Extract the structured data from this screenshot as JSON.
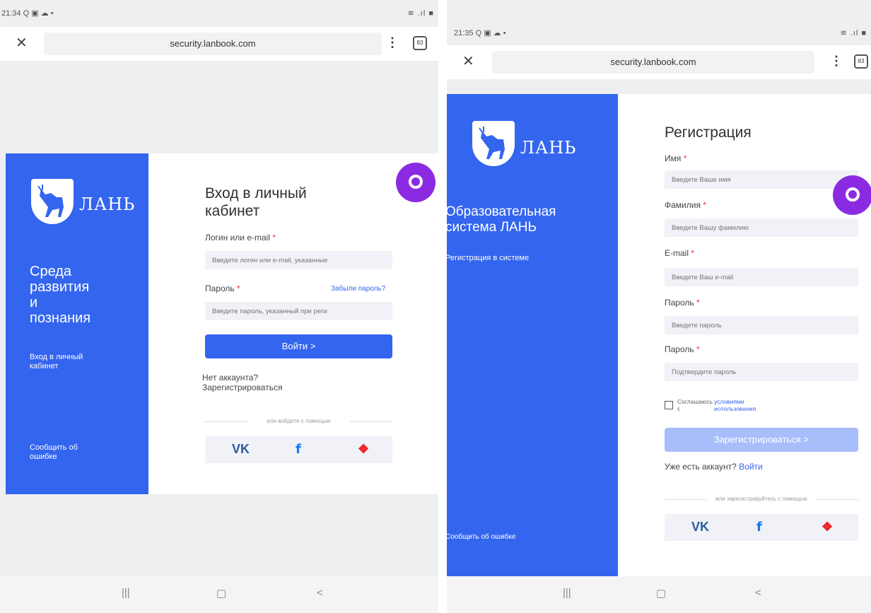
{
  "login": {
    "status": {
      "time": "21:34",
      "icons": "Q ▣ ☁ •",
      "signal": "≋ .ıl ■"
    },
    "browser": {
      "url": "security.lanbook.com",
      "tabs_count": "83"
    },
    "brand": {
      "logo_text": "ЛАНЬ"
    },
    "sidebar": {
      "tagline_line1": "Среда",
      "tagline_line2": "развития",
      "tagline_line3": "и",
      "tagline_line4": "познания",
      "sub_line1": "Вход в личный",
      "sub_line2": "кабинет",
      "report_line1": "Сообщить об",
      "report_line2": "ошибке"
    },
    "form": {
      "title_line1": "Вход в личный",
      "title_line2": "кабинет",
      "login_label": "Логин или e-mail",
      "login_placeholder": "Введите логин или e-mail, указанные",
      "password_label": "Пароль",
      "forgot_link": "Забыли пароль?",
      "password_placeholder": "Введите пароль, указанный при реги",
      "submit": "Войти >",
      "no_account": "Нет аккаунта?",
      "register_link": "Зарегистрироваться",
      "social_divider": "или войдите с помощью"
    },
    "socials": {
      "vk": "VK",
      "fb": "f",
      "lan": "❖"
    },
    "nav": {
      "recent": "|||",
      "home": "▢",
      "back": "<"
    }
  },
  "register": {
    "status": {
      "time": "21:35",
      "icons": "Q ▣ ☁ •",
      "signal": "≋ .ıl ■"
    },
    "browser": {
      "url": "security.lanbook.com",
      "tabs_count": "83"
    },
    "brand": {
      "logo_text": "ЛАНЬ"
    },
    "sidebar": {
      "tagline_line1": "Образовательная",
      "tagline_line2": "система ЛАНЬ",
      "sub": "Регистрация в системе",
      "report": "Сообщить об ошибке"
    },
    "form": {
      "title": "Регистрация",
      "first_name_label": "Имя",
      "first_name_placeholder": "Введите Ваше имя",
      "last_name_label": "Фамилия",
      "last_name_placeholder": "Введите Вашу фамилию",
      "email_label": "E-mail",
      "email_placeholder": "Введите Ваш e-mail",
      "password_label": "Пароль",
      "password_placeholder": "Введите пароль",
      "password_confirm_label": "Пароль",
      "password_confirm_placeholder": "Подтвердите пароль",
      "agree_text": "Соглашаюсь с",
      "terms_link": "условиями использования",
      "submit": "Зарегистрироваться >",
      "have_account": "Уже есть аккаунт?",
      "login_link": "Войти",
      "social_divider": "или зарегистрируйтесь с помощью"
    },
    "socials": {
      "vk": "VK",
      "fb": "f",
      "lan": "❖"
    },
    "nav": {
      "recent": "|||",
      "home": "▢",
      "back": "<"
    }
  }
}
